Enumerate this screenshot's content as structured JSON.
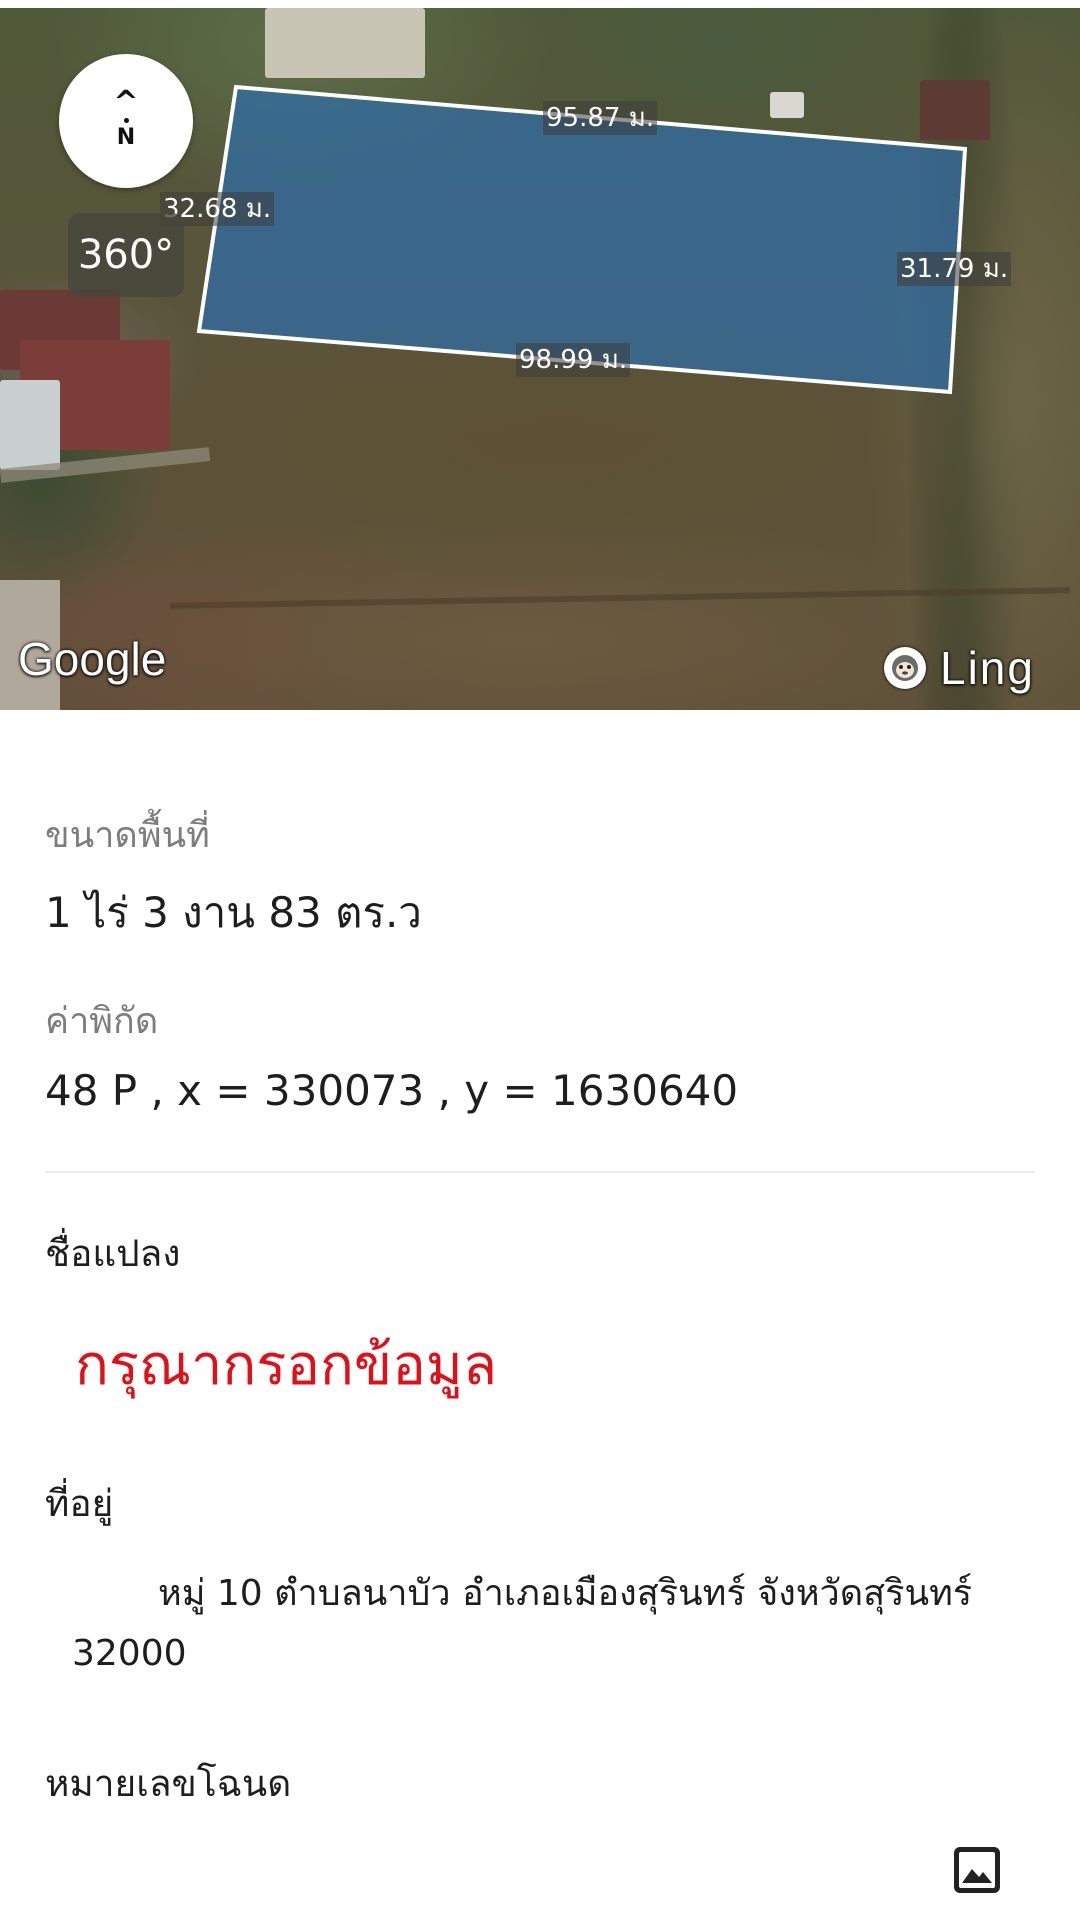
{
  "map": {
    "compass": {
      "arrow": "^",
      "label": "N"
    },
    "btn_360_label": "360°",
    "google_label": "Google",
    "ling_label": "Ling",
    "dimensions": {
      "top": "95.87 ม.",
      "left": "32.68 ม.",
      "right": "31.79 ม.",
      "bottom": "98.99 ม."
    },
    "plot_fill_color": "#2f6ea8",
    "plot_outline_color": "#ffffff"
  },
  "details": {
    "area": {
      "label": "ขนาดพื้นที่",
      "value": "1 ไร่ 3 งาน 83 ตร.ว"
    },
    "coordinates": {
      "label": "ค่าพิกัด",
      "value": "48 P , x = 330073 , y = 1630640"
    },
    "plot_name": {
      "label": "ชื่อแปลง",
      "placeholder": "กรุณากรอกข้อมูล",
      "placeholder_color": "#e01018"
    },
    "address": {
      "label": "ที่อยู่",
      "value": "หมู่ 10 ตำบลนาบัว อำเภอเมืองสุรินทร์ จังหวัดสุรินทร์ 32000"
    },
    "deed_number": {
      "label": "หมายเลขโฉนด",
      "image_icon": "image-icon"
    }
  }
}
